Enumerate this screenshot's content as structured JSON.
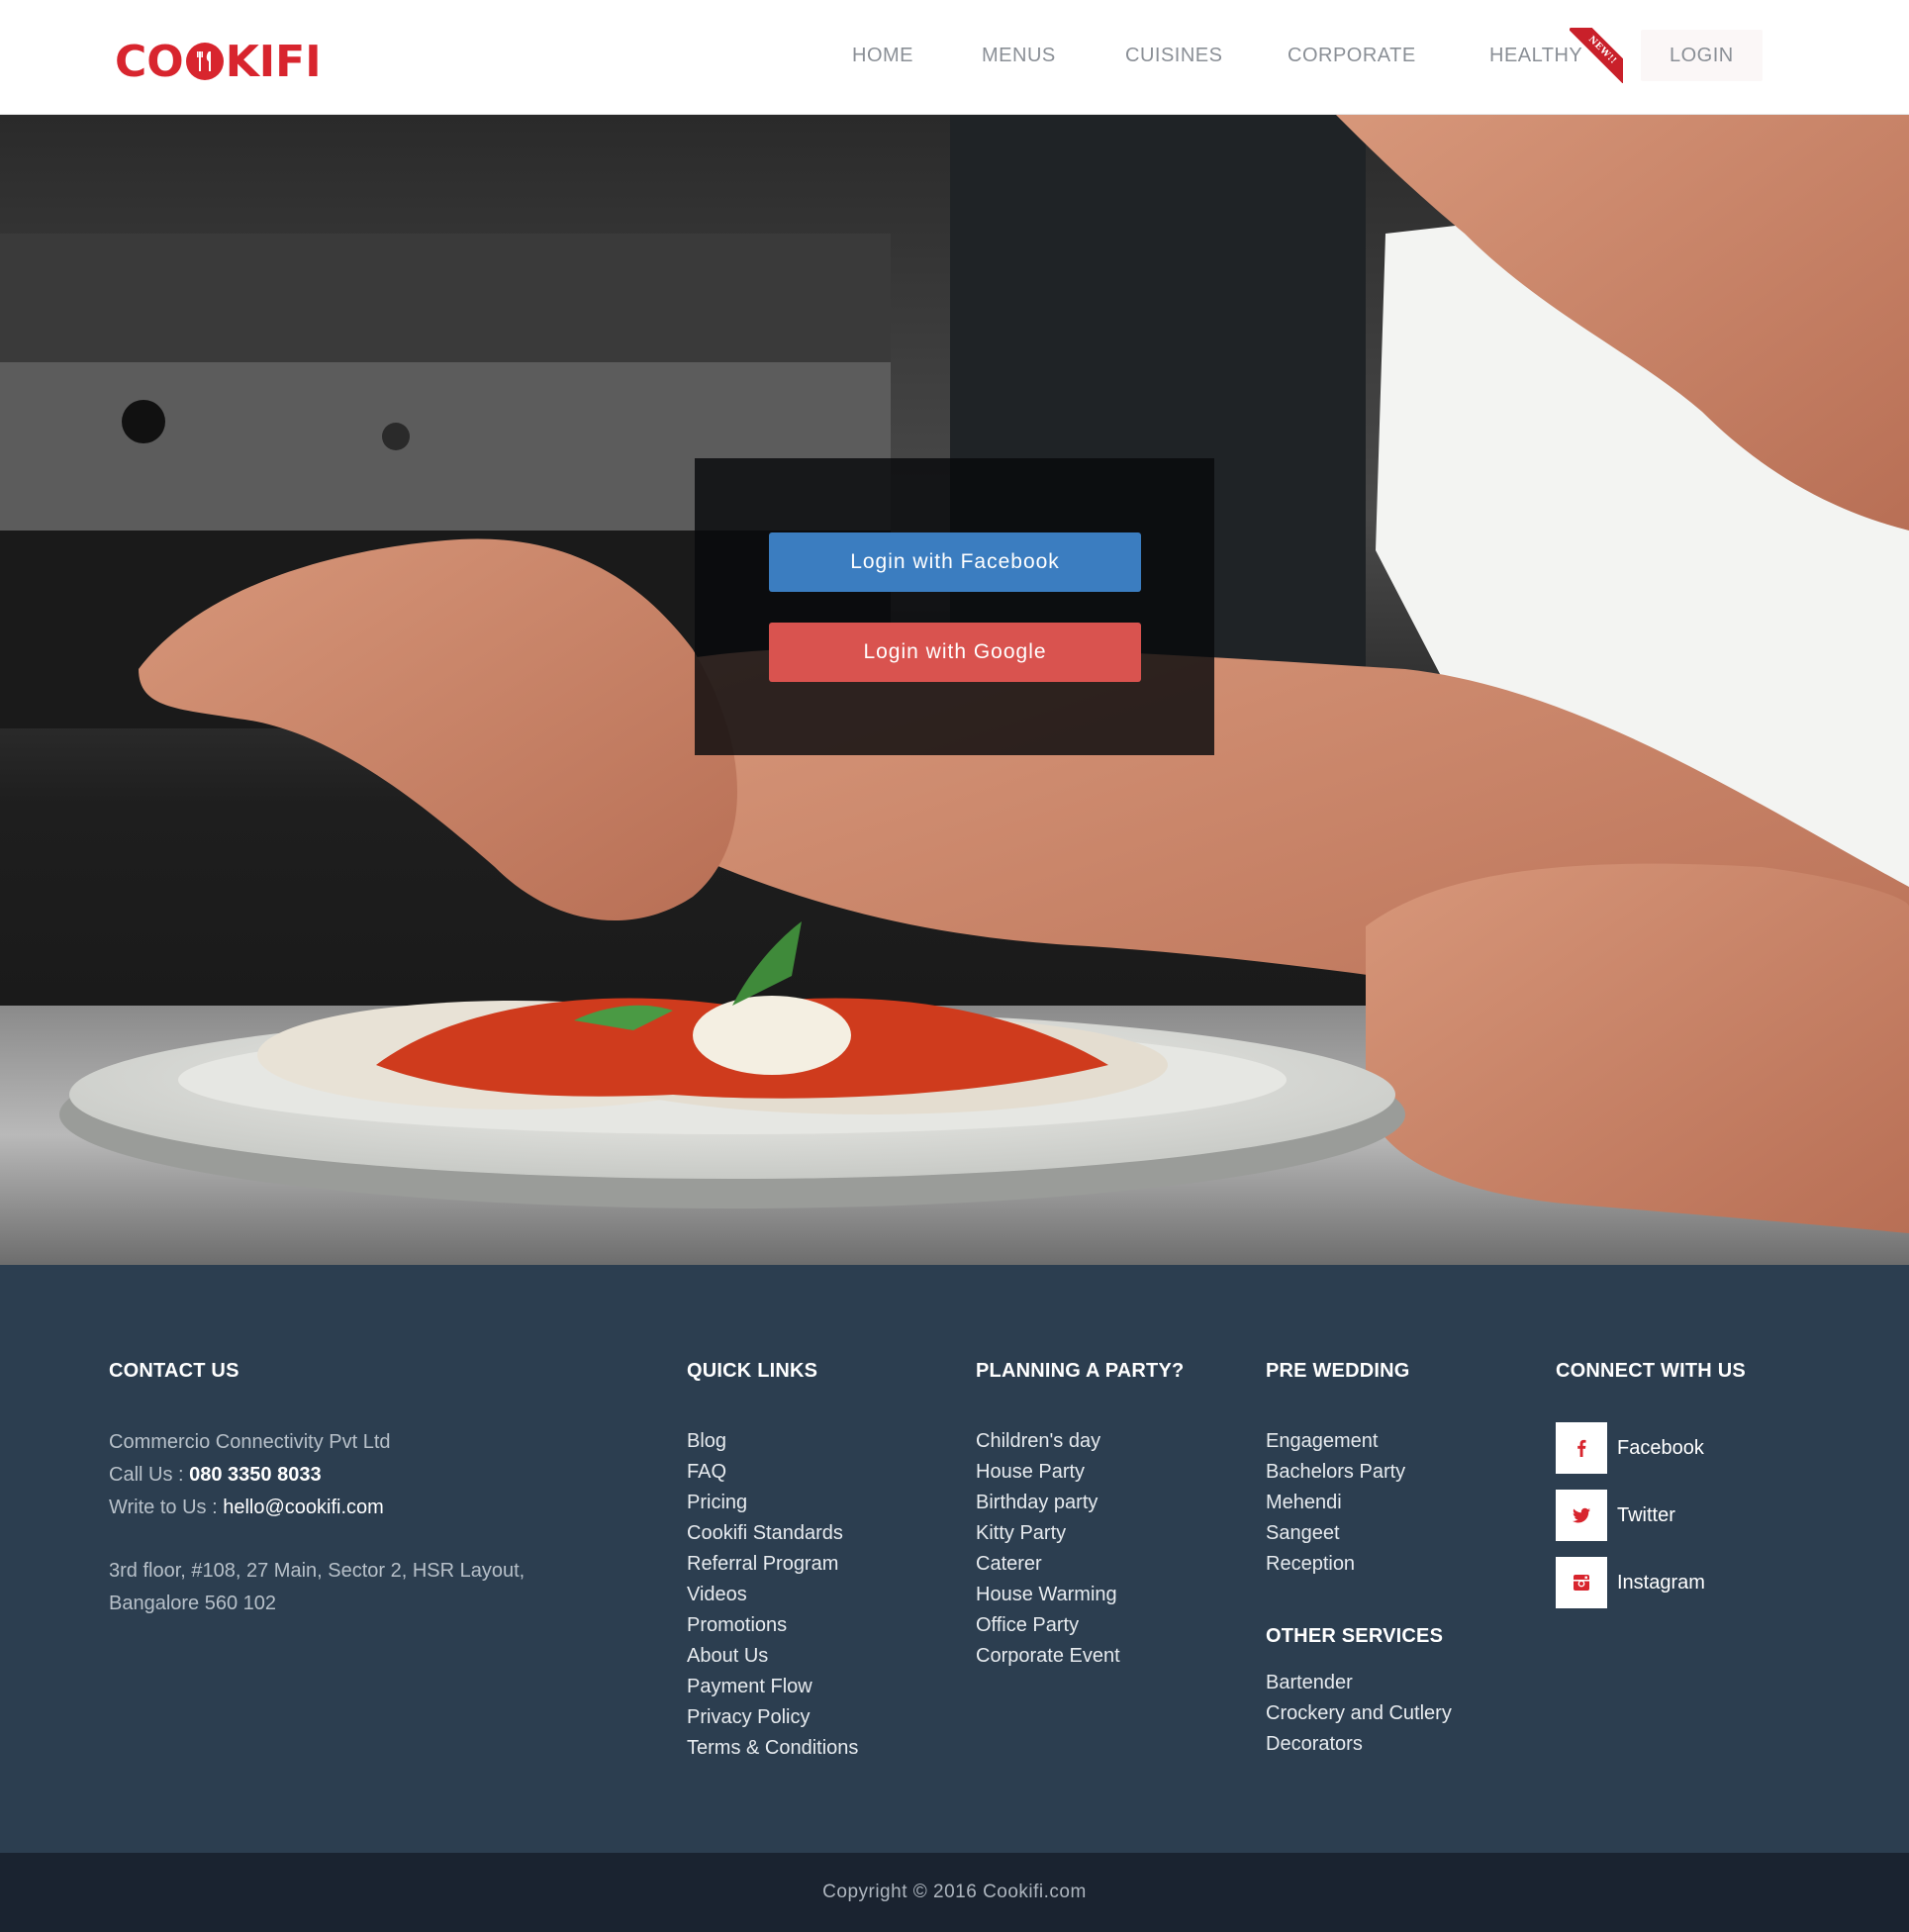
{
  "brand": {
    "name": "COOKIFI",
    "prefix": "CO",
    "suffix": "KIFI",
    "color": "#d8252e"
  },
  "nav": {
    "items": [
      "HOME",
      "MENUS",
      "CUISINES",
      "CORPORATE",
      "HEALTHY",
      "LOGIN"
    ],
    "ribbon": "NEW!!"
  },
  "login": {
    "facebook_label": "Login with Facebook",
    "google_label": "Login with Google",
    "facebook_color": "#3b7dc0",
    "google_color": "#d9534f"
  },
  "footer": {
    "contact": {
      "heading": "CONTACT US",
      "company": "Commercio Connectivity Pvt Ltd",
      "call_prefix": "Call Us : ",
      "phone": "080 3350 8033",
      "write_prefix": "Write to Us : ",
      "email": "hello@cookifi.com",
      "address_line1": "3rd floor, #108, 27 Main, Sector 2, HSR Layout,",
      "address_line2": "Bangalore 560 102"
    },
    "quick_links": {
      "heading": "QUICK LINKS",
      "items": [
        "Blog",
        "FAQ",
        "Pricing",
        "Cookifi Standards",
        "Referral Program",
        "Videos",
        "Promotions",
        "About Us",
        "Payment Flow",
        "Privacy Policy",
        "Terms & Conditions"
      ]
    },
    "planning": {
      "heading": "PLANNING A PARTY?",
      "items": [
        "Children's day",
        "House Party",
        "Birthday party",
        "Kitty Party",
        "Caterer",
        "House Warming",
        "Office Party",
        "Corporate Event"
      ]
    },
    "pre_wedding": {
      "heading": "PRE WEDDING",
      "items": [
        "Engagement",
        "Bachelors Party",
        "Mehendi",
        "Sangeet",
        "Reception"
      ]
    },
    "other_services": {
      "heading": "OTHER SERVICES",
      "items": [
        "Bartender",
        "Crockery and Cutlery",
        "Decorators"
      ]
    },
    "connect": {
      "heading": "CONNECT WITH US",
      "items": [
        {
          "label": "Facebook",
          "icon": "facebook-icon"
        },
        {
          "label": "Twitter",
          "icon": "twitter-icon"
        },
        {
          "label": "Instagram",
          "icon": "instagram-icon"
        }
      ]
    },
    "copyright": "Copyright © 2016 Cookifi.com",
    "colors": {
      "background": "#2c3e50",
      "bottom_bar": "#1a2330",
      "icon_accent": "#d8252e"
    }
  }
}
